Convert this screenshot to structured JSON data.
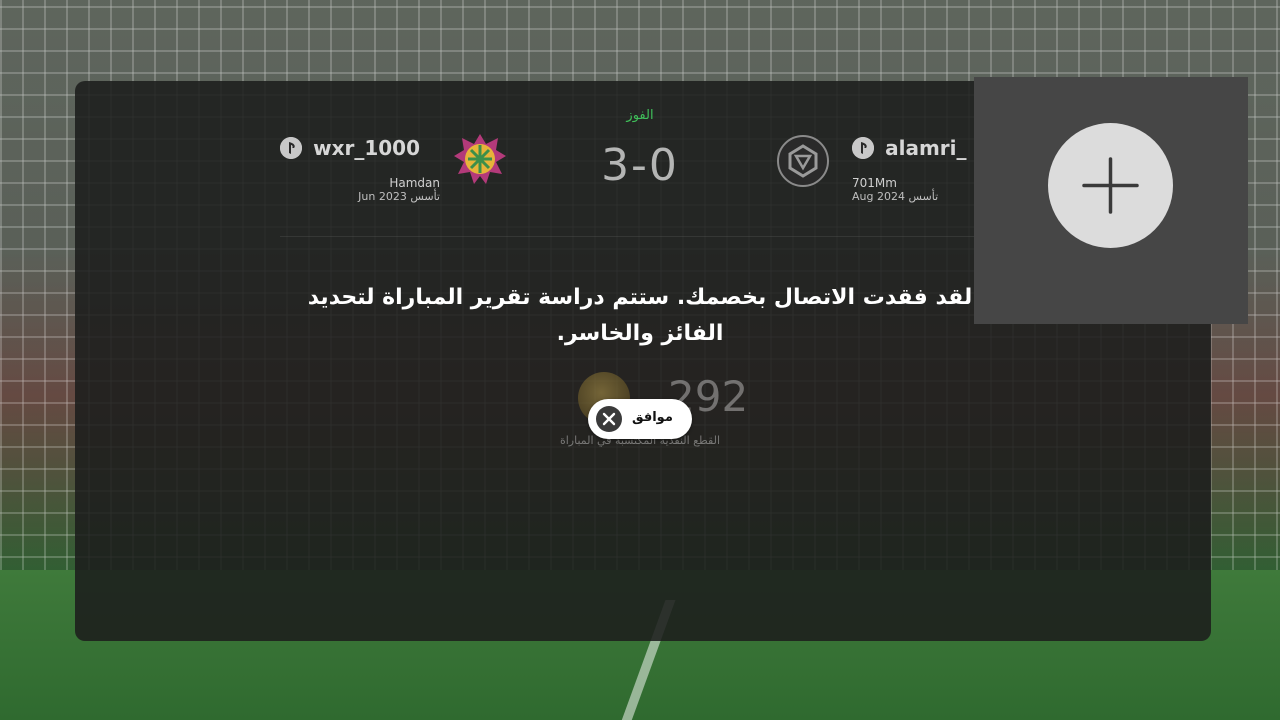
{
  "match": {
    "result_label": "الفوز",
    "score": "3-0"
  },
  "home_team": {
    "platform_icon": "playstation-icon",
    "player": "wxr_1000",
    "club": "Hamdan",
    "founded_label": "تأسس",
    "founded_date": "Jun 2023"
  },
  "away_team": {
    "platform_icon": "playstation-icon",
    "player": "alamri_",
    "club": "701Mm",
    "founded_label": "تأسس",
    "founded_date": "Aug 2024"
  },
  "dialog": {
    "message": "لقد فقدت الاتصال بخصمك. ستتم دراسة تقرير المباراة لتحديد الفائز والخاسر.",
    "ok_label": "موافق"
  },
  "rewards": {
    "coins_value": "292",
    "coins_label": "القطع النقدية المكتسبة في المباراة"
  },
  "colors": {
    "win": "#3fc05a",
    "panel": "#1c1e1c",
    "overlay": "#464646"
  }
}
